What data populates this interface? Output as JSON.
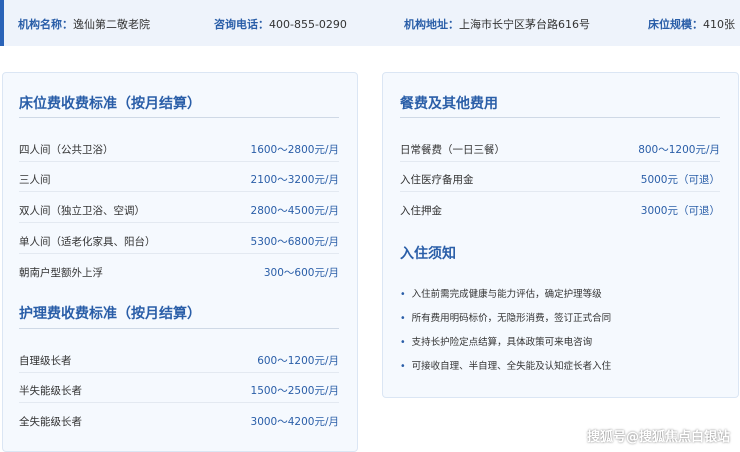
{
  "info": {
    "name_label": "机构名称：",
    "name_value": "逸仙第二敬老院",
    "phone_label": "咨询电话：",
    "phone_value": "400-855-0290",
    "address_label": "机构地址：",
    "address_value": "上海市长宁区茅台路616号",
    "beds_label": "床位规模：",
    "beds_value": "410张"
  },
  "bed_fees": {
    "title": "床位费收费标准（按月结算）",
    "rows": [
      {
        "name": "四人间（公共卫浴）",
        "price": "1600～2800元/月"
      },
      {
        "name": "三人间",
        "price": "2100～3200元/月"
      },
      {
        "name": "双人间（独立卫浴、空调）",
        "price": "2800～4500元/月"
      },
      {
        "name": "单人间（适老化家具、阳台）",
        "price": "5300～6800元/月"
      },
      {
        "name": "朝南户型额外上浮",
        "price": "300～600元/月"
      }
    ]
  },
  "care_fees": {
    "title": "护理费收费标准（按月结算）",
    "rows": [
      {
        "name": "自理级长者",
        "price": "600～1200元/月"
      },
      {
        "name": "半失能级长者",
        "price": "1500～2500元/月"
      },
      {
        "name": "全失能级长者",
        "price": "3000～4200元/月"
      }
    ]
  },
  "other_fees": {
    "title": "餐费及其他费用",
    "rows": [
      {
        "name": "日常餐费（一日三餐）",
        "price": "800～1200元/月"
      },
      {
        "name": "入住医疗备用金",
        "price": "5000元（可退）"
      },
      {
        "name": "入住押金",
        "price": "3000元（可退）"
      }
    ]
  },
  "notice": {
    "title": "入住须知",
    "items": [
      "入住前需完成健康与能力评估，确定护理等级",
      "所有费用明码标价，无隐形消费，签订正式合同",
      "支持长护险定点结算，具体政策可来电咨询",
      "可接收自理、半自理、全失能及认知症长者入住"
    ],
    "bullet": "•"
  },
  "watermark": "搜狐号@搜狐焦点白银站",
  "colors": {
    "accent": "#2a5ea8",
    "card_bg": "#f5f9fe",
    "bar_bg": "#eef3fb"
  }
}
